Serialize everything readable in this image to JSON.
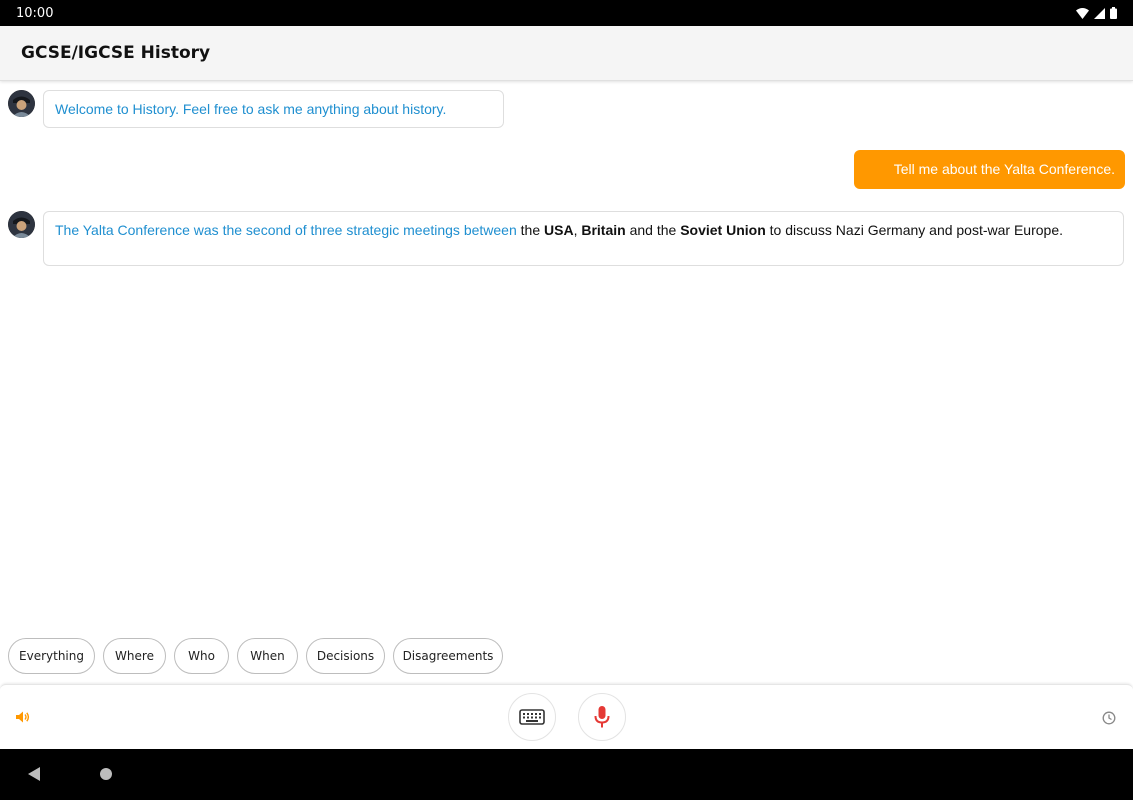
{
  "status_bar": {
    "time": "10:00"
  },
  "app_bar": {
    "title": "GCSE/IGCSE History"
  },
  "messages": {
    "welcome": "Welcome to History. Feel free to ask me anything about history.",
    "user_question": "Tell me about the Yalta Conference.",
    "answer": {
      "part1": "The Yalta Conference was the second of three strategic meetings between",
      "part2": " the ",
      "part3": "USA",
      "part4": ", ",
      "part5": "Britain",
      "part6": " and the ",
      "part7": "Soviet Union",
      "part8": " to discuss Nazi Germany and post-war Europe."
    }
  },
  "chips": [
    "Everything",
    "Where",
    "Who",
    "When",
    "Decisions",
    "Disagreements"
  ],
  "colors": {
    "accent": "#ff9800",
    "bot_text": "#1f8fd0",
    "mic": "#e53935"
  },
  "icons": {
    "speaker": "speaker-icon",
    "keyboard": "keyboard-icon",
    "mic": "microphone-icon",
    "history": "history-icon"
  }
}
